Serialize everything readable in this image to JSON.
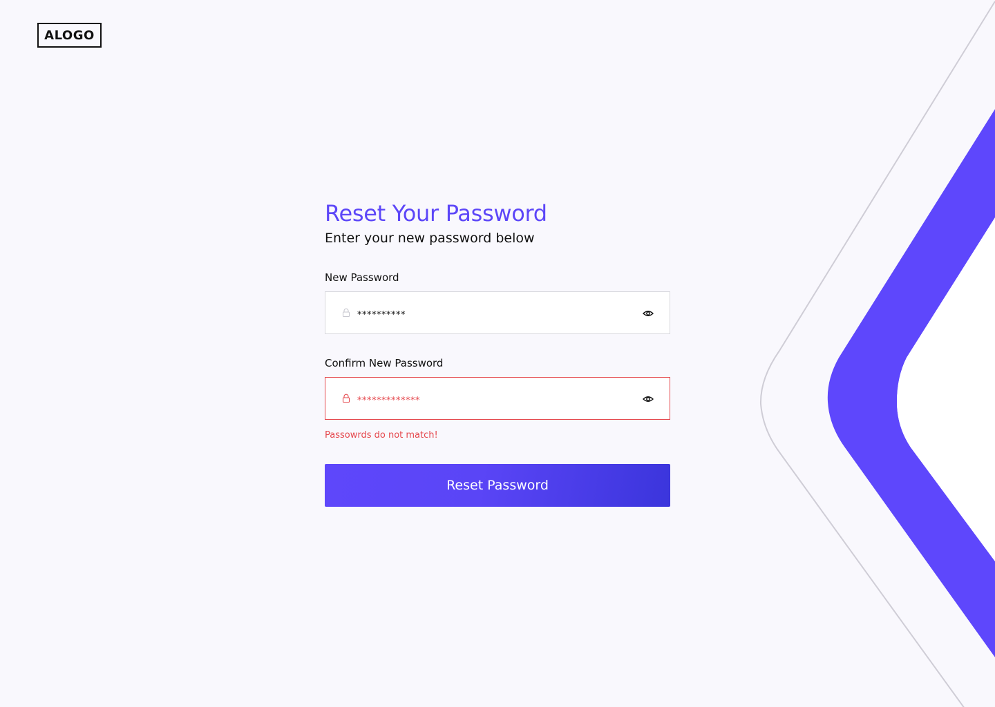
{
  "brand": {
    "logo_text": "ALOGO"
  },
  "header": {
    "title": "Reset Your Password",
    "subtitle": "Enter your new password below"
  },
  "fields": [
    {
      "label": "New Password",
      "value": "**********",
      "state": "default",
      "icon": "lock-icon",
      "toggle_icon": "eye-icon"
    },
    {
      "label": "Confirm New Password",
      "value": "*************",
      "state": "error",
      "icon": "lock-icon",
      "toggle_icon": "eye-icon",
      "error_message": "Passowrds do not match!"
    }
  ],
  "actions": {
    "submit_label": "Reset Password"
  },
  "colors": {
    "accent": "#5c46f8",
    "error": "#e5484d",
    "background": "#f9f8fd"
  }
}
